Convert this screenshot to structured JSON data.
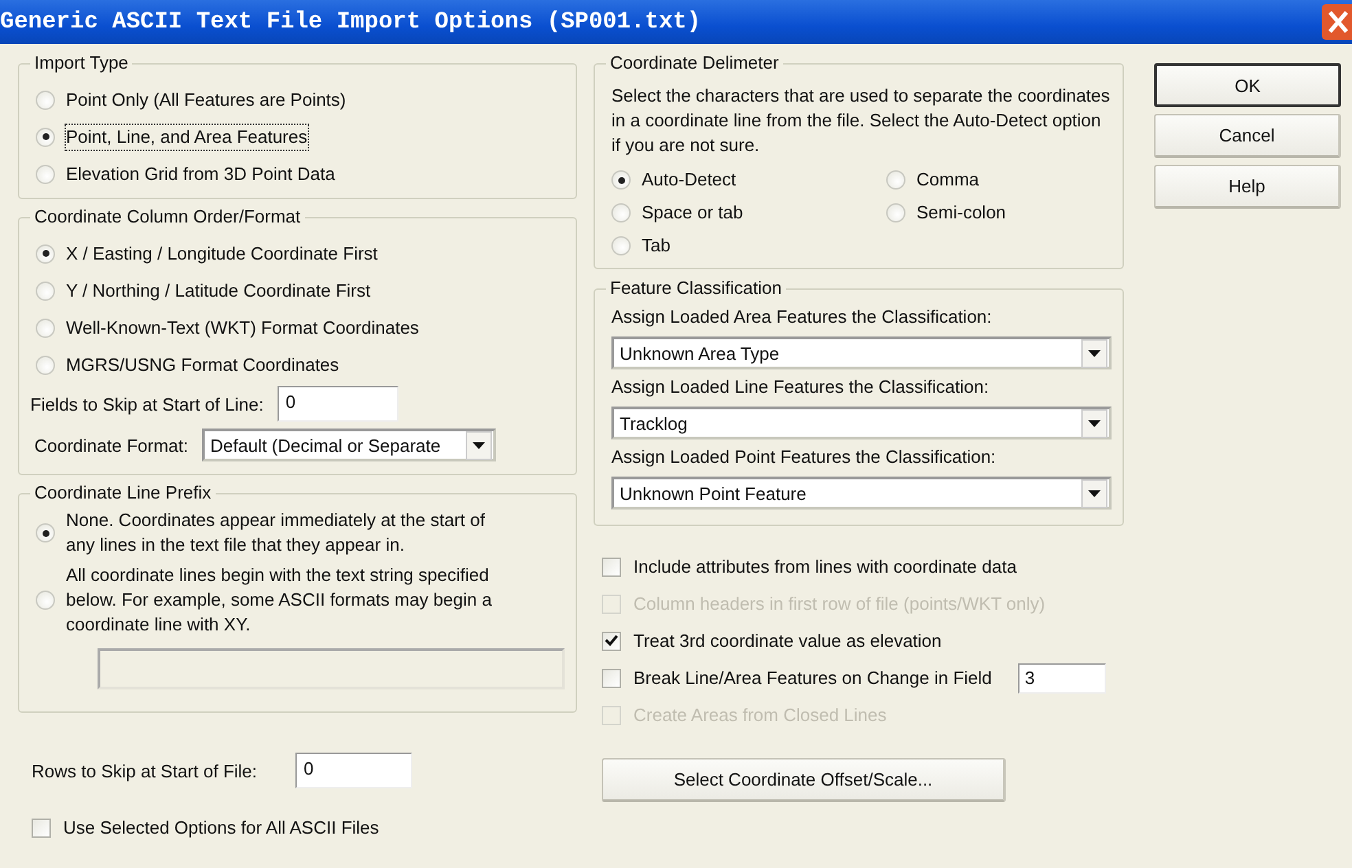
{
  "window": {
    "title": "Generic ASCII Text File Import Options (SP001.txt)"
  },
  "import_type": {
    "title": "Import Type",
    "options": [
      {
        "label": "Point Only (All Features are Points)",
        "selected": false,
        "focused": false
      },
      {
        "label": "Point, Line, and Area Features",
        "selected": true,
        "focused": true
      },
      {
        "label": "Elevation Grid from 3D Point Data",
        "selected": false,
        "focused": false
      }
    ]
  },
  "column_order": {
    "title": "Coordinate Column Order/Format",
    "options": [
      {
        "label": "X / Easting / Longitude Coordinate First",
        "selected": true
      },
      {
        "label": "Y / Northing / Latitude Coordinate First",
        "selected": false
      },
      {
        "label": "Well-Known-Text (WKT) Format Coordinates",
        "selected": false
      },
      {
        "label": "MGRS/USNG Format Coordinates",
        "selected": false
      }
    ],
    "fields_to_skip": {
      "label": "Fields to Skip at Start of Line:",
      "value": "0"
    },
    "coordinate_format": {
      "label": "Coordinate Format:",
      "value": "Default (Decimal or Separate"
    }
  },
  "line_prefix": {
    "title": "Coordinate Line Prefix",
    "options": [
      {
        "label": "None. Coordinates appear immediately at the start of any lines in the text file that they appear in.",
        "selected": true
      },
      {
        "label": "All coordinate lines begin with the text string specified below. For example, some ASCII formats may begin a coordinate line with XY.",
        "selected": false
      }
    ]
  },
  "rows_to_skip": {
    "label": "Rows to Skip at Start of File:",
    "value": "0"
  },
  "use_for_all": {
    "label": "Use Selected Options for All ASCII Files",
    "checked": false
  },
  "delimiter": {
    "title": "Coordinate Delimeter",
    "description": "Select the characters that are used to separate the coordinates in a coordinate line from the file. Select the Auto-Detect option if you are not sure.",
    "options": [
      {
        "label": "Auto-Detect",
        "selected": true
      },
      {
        "label": "Space or tab",
        "selected": false
      },
      {
        "label": "Tab",
        "selected": false
      },
      {
        "label": "Comma",
        "selected": false
      },
      {
        "label": "Semi-colon",
        "selected": false
      }
    ]
  },
  "feature_classification": {
    "title": "Feature Classification",
    "assignments": [
      {
        "label": "Assign Loaded Area Features the Classification:",
        "value": "Unknown Area Type"
      },
      {
        "label": "Assign Loaded Line Features the Classification:",
        "value": "Tracklog"
      },
      {
        "label": "Assign Loaded Point Features the Classification:",
        "value": "Unknown Point Feature"
      }
    ]
  },
  "options": [
    {
      "label": "Include attributes from lines with coordinate data",
      "checked": false,
      "disabled": false
    },
    {
      "label": "Column headers in first row of file (points/WKT only)",
      "checked": false,
      "disabled": true
    },
    {
      "label": "Treat 3rd coordinate value as elevation",
      "checked": true,
      "disabled": false
    },
    {
      "label": "Break Line/Area Features on Change in Field",
      "checked": false,
      "disabled": false,
      "field": "3"
    },
    {
      "label": "Create Areas from Closed Lines",
      "checked": false,
      "disabled": true
    }
  ],
  "offset_button": "Select Coordinate Offset/Scale...",
  "buttons": [
    {
      "label": "OK",
      "default": true
    },
    {
      "label": "Cancel",
      "default": false
    },
    {
      "label": "Help",
      "default": false
    }
  ]
}
